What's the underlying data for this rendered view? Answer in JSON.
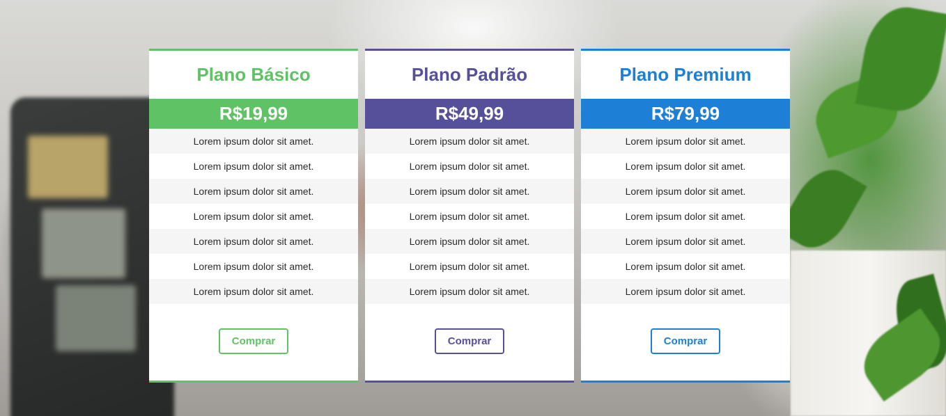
{
  "plans": [
    {
      "title": "Plano Básico",
      "price": "R$19,99",
      "accent": "#5fc264",
      "features": [
        "Lorem ipsum dolor sit amet.",
        "Lorem ipsum dolor sit amet.",
        "Lorem ipsum dolor sit amet.",
        "Lorem ipsum dolor sit amet.",
        "Lorem ipsum dolor sit amet.",
        "Lorem ipsum dolor sit amet.",
        "Lorem ipsum dolor sit amet."
      ],
      "button_label": "Comprar"
    },
    {
      "title": "Plano Padrão",
      "price": "R$49,99",
      "accent": "#56509a",
      "features": [
        "Lorem ipsum dolor sit amet.",
        "Lorem ipsum dolor sit amet.",
        "Lorem ipsum dolor sit amet.",
        "Lorem ipsum dolor sit amet.",
        "Lorem ipsum dolor sit amet.",
        "Lorem ipsum dolor sit amet.",
        "Lorem ipsum dolor sit amet."
      ],
      "button_label": "Comprar"
    },
    {
      "title": "Plano Premium",
      "price": "R$79,99",
      "accent": "#1e7fd6",
      "features": [
        "Lorem ipsum dolor sit amet.",
        "Lorem ipsum dolor sit amet.",
        "Lorem ipsum dolor sit amet.",
        "Lorem ipsum dolor sit amet.",
        "Lorem ipsum dolor sit amet.",
        "Lorem ipsum dolor sit amet.",
        "Lorem ipsum dolor sit amet."
      ],
      "button_label": "Comprar"
    }
  ]
}
